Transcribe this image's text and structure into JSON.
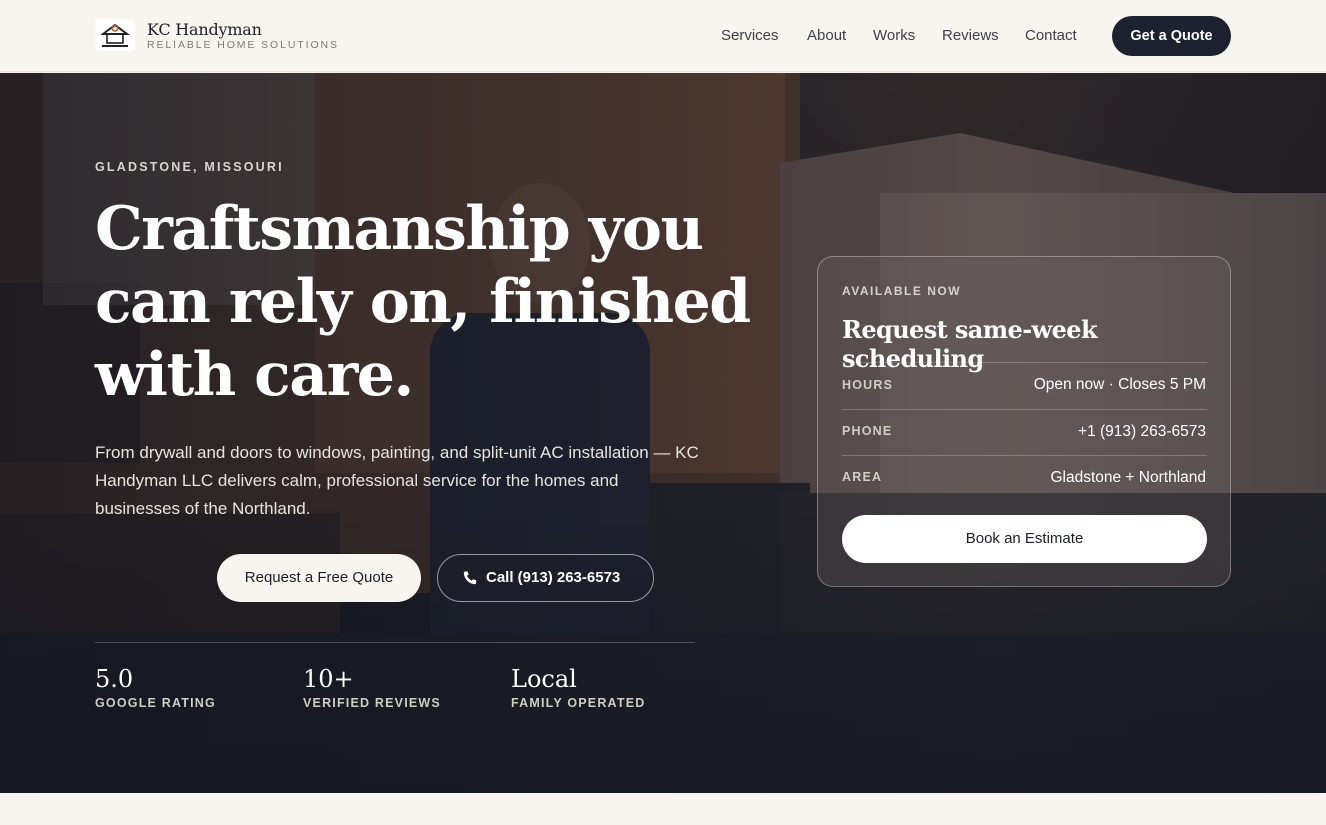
{
  "header": {
    "brand_name": "KC Handyman",
    "brand_tagline": "RELIABLE HOME SOLUTIONS",
    "nav": [
      "Services",
      "About",
      "Works",
      "Reviews",
      "Contact"
    ],
    "cta": "Get a Quote"
  },
  "hero": {
    "eyebrow": "GLADSTONE, MISSOURI",
    "headline": "Craftsmanship you can rely on, finished with care.",
    "lede": "From drywall and doors to windows, painting, and split-unit AC installation — KC Handyman LLC delivers calm, professional service for the homes and businesses of the Northland.",
    "primary_button": "Request a Free Quote",
    "call_button": "Call (913) 263-6573",
    "stats": [
      {
        "value": "5.0",
        "label": "GOOGLE RATING"
      },
      {
        "value": "10+",
        "label": "VERIFIED REVIEWS"
      },
      {
        "value": "Local",
        "label": "FAMILY OPERATED"
      }
    ]
  },
  "card": {
    "eyebrow": "AVAILABLE NOW",
    "title": "Request same-week scheduling",
    "rows": [
      {
        "label": "HOURS",
        "value": "Open now · Closes 5 PM"
      },
      {
        "label": "PHONE",
        "value": "+1 (913) 263-6573"
      },
      {
        "label": "AREA",
        "value": "Gladstone + Northland"
      }
    ],
    "button": "Book an Estimate"
  },
  "colors": {
    "background": "#f8f5f0",
    "dark_button": "#1d2130",
    "hero_overlay": "#1b1c26"
  }
}
